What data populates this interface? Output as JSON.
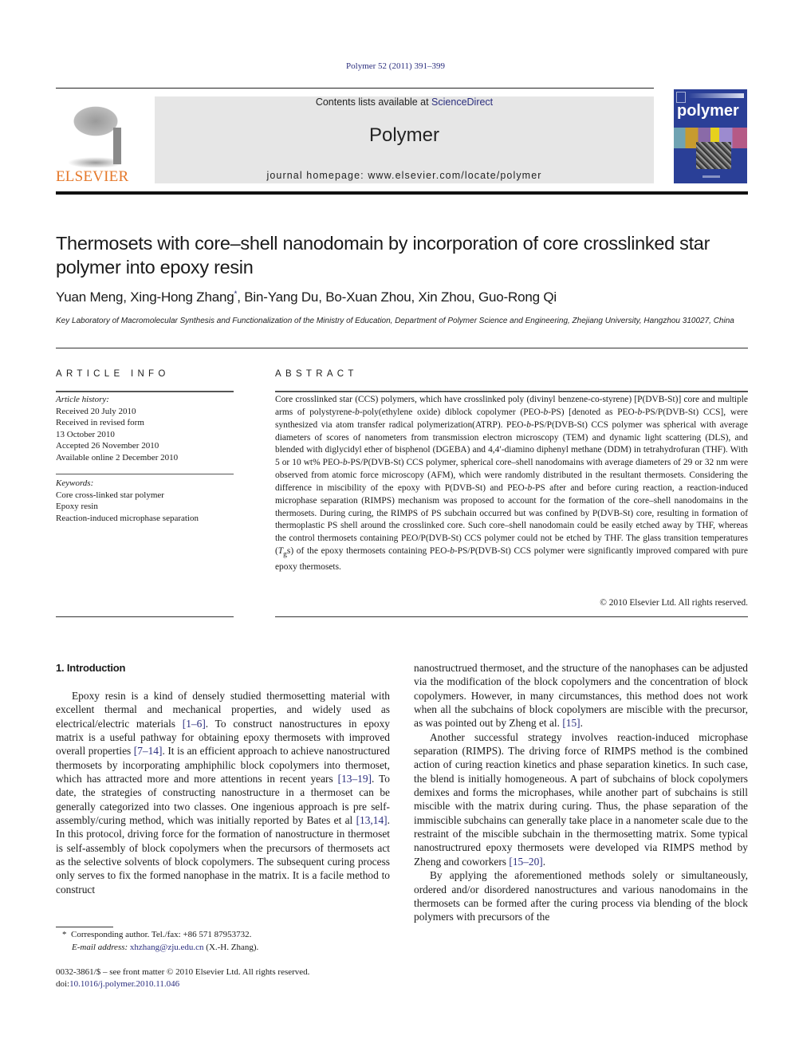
{
  "header": {
    "citation": "Polymer 52 (2011) 391–399",
    "publisher_logo_text": "ELSEVIER",
    "contents_prefix": "Contents lists available at ",
    "contents_link": "ScienceDirect",
    "journal_title": "Polymer",
    "homepage_prefix": "journal homepage: ",
    "homepage_url": "www.elsevier.com/locate/polymer",
    "cover_title": "polymer",
    "colors": {
      "link": "#2b2e7e",
      "elsevier_orange": "#e5782a",
      "cover_blue": "#2a3f97",
      "band_gray": "#e6e6e6"
    }
  },
  "article": {
    "title": "Thermosets with core–shell nanodomain by incorporation of core crosslinked star polymer into epoxy resin",
    "authors_before": "Yuan Meng, Xing-Hong Zhang",
    "corresponding_mark": "*",
    "authors_after": ", Bin-Yang Du, Bo-Xuan Zhou, Xin Zhou, Guo-Rong Qi",
    "affiliation": "Key Laboratory of Macromolecular Synthesis and Functionalization of the Ministry of Education, Department of Polymer Science and Engineering, Zhejiang University, Hangzhou 310027, China"
  },
  "article_info": {
    "heading": "ARTICLE INFO",
    "history_label": "Article history:",
    "history": [
      "Received 20 July 2010",
      "Received in revised form",
      "13 October 2010",
      "Accepted 26 November 2010",
      "Available online 2 December 2010"
    ],
    "keywords_label": "Keywords:",
    "keywords": [
      "Core cross-linked star polymer",
      "Epoxy resin",
      "Reaction-induced microphase separation"
    ]
  },
  "abstract": {
    "heading": "ABSTRACT",
    "p1": "Core crosslinked star (CCS) polymers, which have crosslinked poly (divinyl benzene-co-styrene) [P(DVB-St)] core and multiple arms of polystyrene-",
    "b1": "b",
    "p2": "-poly(ethylene oxide) diblock copolymer (PEO-",
    "b2": "b",
    "p3": "-PS) [denoted as PEO-",
    "b3": "b",
    "p4": "-PS/P(DVB-St) CCS], were synthesized via atom transfer radical polymerization(ATRP). PEO-",
    "b4": "b",
    "p5": "-PS/P(DVB-St) CCS polymer was spherical with average diameters of scores of nanometers from transmission electron microscopy (TEM) and dynamic light scattering (DLS), and blended with diglycidyl ether of bisphenol (DGEBA) and 4,4′-diamino diphenyl methane (DDM) in tetrahydrofuran (THF). With 5 or 10 wt% PEO-",
    "b5": "b",
    "p6": "-PS/P(DVB-St) CCS polymer, spherical core–shell nanodomains with average diameters of 29 or 32 nm were observed from atomic force microscopy (AFM), which were randomly distributed in the resultant thermosets. Considering the difference in miscibility of the epoxy with P(DVB-St) and PEO-",
    "b6": "b",
    "p7": "-PS after and before curing reaction, a reaction-induced microphase separation (RIMPS) mechanism was proposed to account for the formation of the core–shell nanodomains in the thermosets. During curing, the RIMPS of PS subchain occurred but was confined by P(DVB-St) core, resulting in formation of thermoplastic PS shell around the crosslinked core. Such core–shell nanodomain could be easily etched away by THF, whereas the control thermosets containing PEO/P(DVB-St) CCS polymer could not be etched by THF. The glass transition temperatures (",
    "tg_T": "T",
    "tg_sub": "g",
    "p8": "s) of the epoxy thermosets containing PEO-",
    "b7": "b",
    "p9": "-PS/P(DVB-St) CCS polymer were significantly improved compared with pure epoxy thermosets.",
    "copyright": "© 2010 Elsevier Ltd. All rights reserved."
  },
  "body": {
    "section_heading": "1.  Introduction",
    "left_p1": [
      {
        "t": "Epoxy resin is a kind of densely studied thermosetting material with excellent thermal and mechanical properties, and widely used as electrical/electric materials "
      },
      {
        "ref": "[1–6]"
      },
      {
        "t": ". To construct nanostructures in epoxy matrix is a useful pathway for obtaining epoxy thermosets with improved overall properties "
      },
      {
        "ref": "[7–14]"
      },
      {
        "t": ". It is an efficient approach to achieve nanostructured thermosets by incorporating amphiphilic block copolymers into thermoset, which has attracted more and more attentions in recent years "
      },
      {
        "ref": "[13–19]"
      },
      {
        "t": ". To date, the strategies of constructing nanostructure in a thermoset can be generally categorized into two classes. One ingenious approach is pre self-assembly/curing method, which was initially reported by Bates et al "
      },
      {
        "ref": "[13,14]"
      },
      {
        "t": ". In this protocol, driving force for the formation of nanostructure in thermoset is self-assembly of block copolymers when the precursors of thermosets act as the selective solvents of block copolymers. The subsequent curing process only serves to fix the formed nanophase in the matrix. It is a facile method to construct"
      }
    ],
    "right_p1": [
      {
        "t": "nanostructrued thermoset, and the structure of the nanophases can be adjusted via the modification of the block copolymers and the concentration of block copolymers. However, in many circumstances, this method does not work when all the subchains of block copolymers are miscible with the precursor, as was pointed out by Zheng et al. "
      },
      {
        "ref": "[15]"
      },
      {
        "t": "."
      }
    ],
    "right_p2": [
      {
        "t": "Another successful strategy involves reaction-induced microphase separation (RIMPS). The driving force of RIMPS method is the combined action of curing reaction kinetics and phase separation kinetics. In such case, the blend is initially homogeneous. A part of subchains of block copolymers demixes and forms the microphases, while another part of subchains is still miscible with the matrix during curing. Thus, the phase separation of the immiscible subchains can generally take place in a nanometer scale due to the restraint of the miscible subchain in the thermosetting matrix. Some typical nanostructrured epoxy thermosets were developed via RIMPS method by Zheng and coworkers "
      },
      {
        "ref": "[15–20]"
      },
      {
        "t": "."
      }
    ],
    "right_p3": [
      {
        "t": "By applying the aforementioned methods solely or simultaneously, ordered and/or disordered nanostructures and various nanodomains in the thermosets can be formed after the curing process via blending of the block polymers with precursors of the"
      }
    ]
  },
  "footnote": {
    "mark": "*",
    "corresponding": "Corresponding author. Tel./fax: +86 571 87953732.",
    "email_label": "E-mail address:",
    "email": "xhzhang@zju.edu.cn",
    "email_suffix": " (X.-H. Zhang)."
  },
  "front_matter": {
    "issn_line": "0032-3861/$ – see front matter © 2010 Elsevier Ltd. All rights reserved.",
    "doi_label": "doi:",
    "doi": "10.1016/j.polymer.2010.11.046"
  }
}
